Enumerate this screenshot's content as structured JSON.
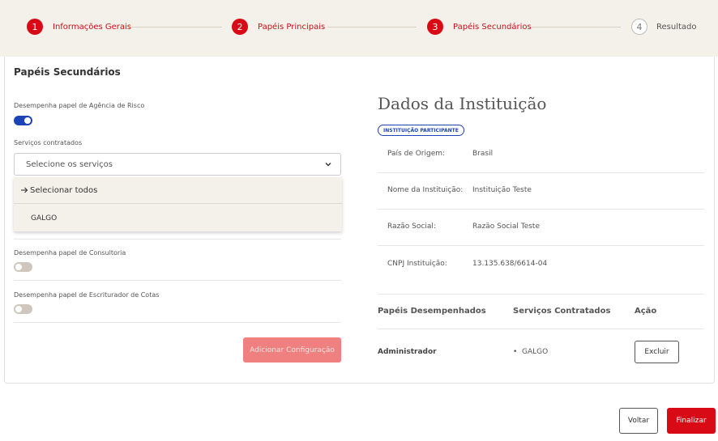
{
  "stepper": {
    "steps": [
      {
        "number": "1",
        "label": "Informações Gerais",
        "state": "done"
      },
      {
        "number": "2",
        "label": "Papéis Principais",
        "state": "done"
      },
      {
        "number": "3",
        "label": "Papéis Secundários",
        "state": "active"
      },
      {
        "number": "4",
        "label": "Resultado",
        "state": "pending"
      }
    ]
  },
  "section": {
    "title": "Papéis Secundários",
    "agencia_risco": {
      "label": "Desempenha papel de Agência de Risco",
      "enabled": true
    },
    "servicos": {
      "label": "Serviços contratados",
      "placeholder": "Selecione os serviços"
    },
    "dropdown": {
      "select_all": "Selecionar todos",
      "options": [
        "GALGO"
      ]
    },
    "consultoria": {
      "label": "Desempenha papel de Consultoria",
      "enabled": false
    },
    "escriturador": {
      "label": "Desempenha papel de Escriturador de Cotas",
      "enabled": false
    },
    "add_button": "Adicionar Configuração"
  },
  "institution": {
    "title": "Dados da Instituição",
    "badge": "INSTITUIÇÃO PARTICIPANTE",
    "fields": [
      {
        "key": "País de Origem:",
        "value": "Brasil"
      },
      {
        "key": "Nome da Instituição:",
        "value": "Instituição Teste"
      },
      {
        "key": "Razão Social:",
        "value": "Razão Social Teste"
      },
      {
        "key": "CNPJ Instituição:",
        "value": "13.135.638/6614-04"
      }
    ],
    "table": {
      "headers": [
        "Papéis Desempenhados",
        "Serviços Contratados",
        "Ação"
      ],
      "rows": [
        {
          "papel": "Administrador",
          "servico": "GALGO",
          "acao": "Excluir"
        }
      ]
    }
  },
  "footer": {
    "back": "Voltar",
    "finish": "Finalizar"
  },
  "colors": {
    "brand_red": "#d70a16",
    "toggle_blue": "#1c44b8",
    "beige": "#f4f0ea"
  }
}
